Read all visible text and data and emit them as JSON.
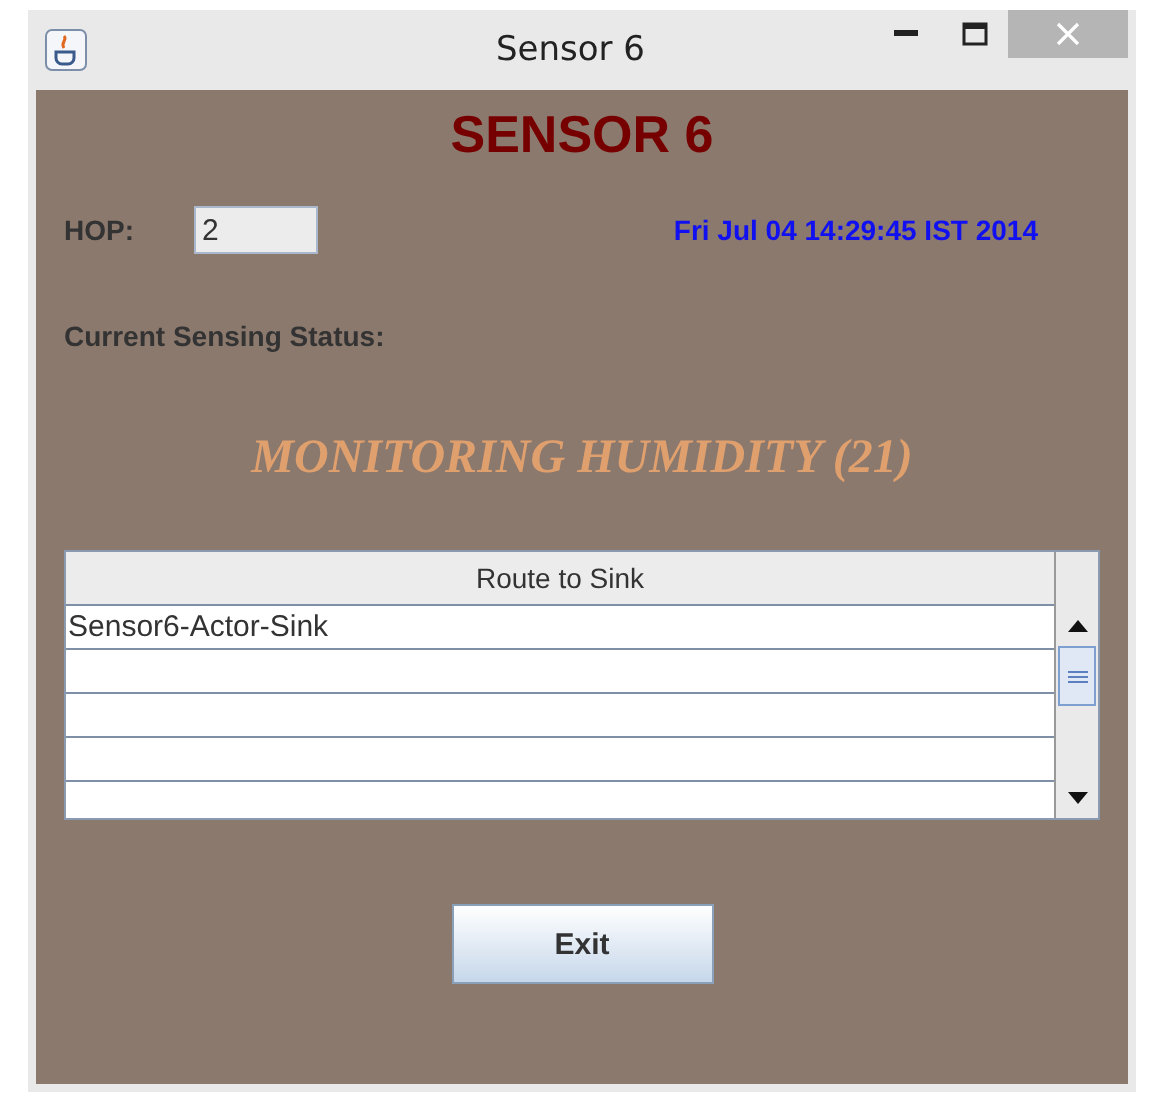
{
  "window": {
    "title": "Sensor 6"
  },
  "heading": "SENSOR 6",
  "hop": {
    "label": "HOP:",
    "value": "2"
  },
  "timestamp": "Fri Jul 04 14:29:45 IST 2014",
  "status_label": "Current Sensing Status:",
  "status": "MONITORING HUMIDITY (21)",
  "table": {
    "columns": [
      "Route to Sink"
    ],
    "rows": [
      "Sensor6-Actor-Sink"
    ]
  },
  "buttons": [
    "Exit"
  ]
}
